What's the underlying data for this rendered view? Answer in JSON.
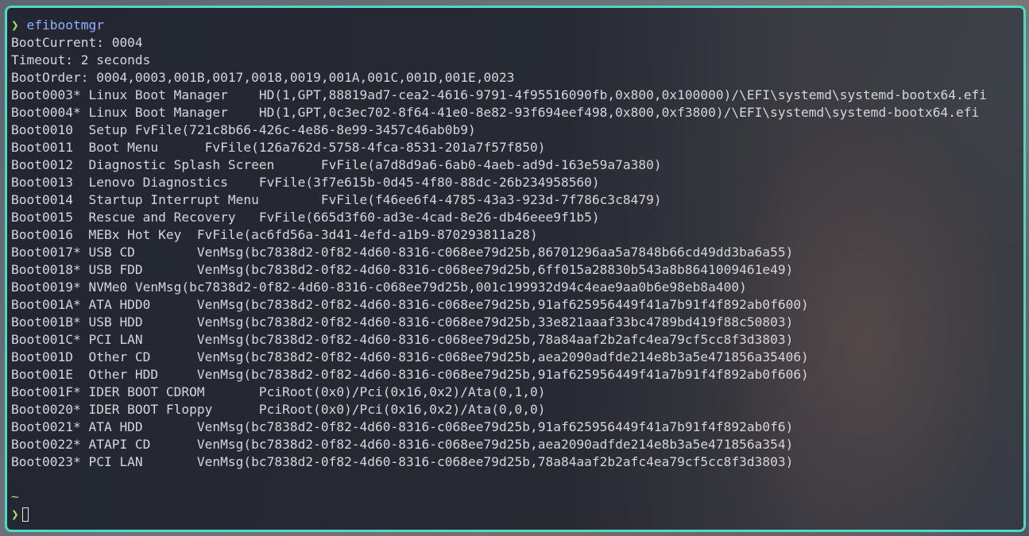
{
  "prompt": {
    "symbol": "❯",
    "command": "efibootmgr"
  },
  "output": [
    "BootCurrent: 0004",
    "Timeout: 2 seconds",
    "BootOrder: 0004,0003,001B,0017,0018,0019,001A,001C,001D,001E,0023",
    "Boot0003* Linux Boot Manager    HD(1,GPT,88819ad7-cea2-4616-9791-4f95516090fb,0x800,0x100000)/\\EFI\\systemd\\systemd-bootx64.efi",
    "Boot0004* Linux Boot Manager    HD(1,GPT,0c3ec702-8f64-41e0-8e82-93f694eef498,0x800,0xf3800)/\\EFI\\systemd\\systemd-bootx64.efi",
    "Boot0010  Setup FvFile(721c8b66-426c-4e86-8e99-3457c46ab0b9)",
    "Boot0011  Boot Menu      FvFile(126a762d-5758-4fca-8531-201a7f57f850)",
    "Boot0012  Diagnostic Splash Screen      FvFile(a7d8d9a6-6ab0-4aeb-ad9d-163e59a7a380)",
    "Boot0013  Lenovo Diagnostics    FvFile(3f7e615b-0d45-4f80-88dc-26b234958560)",
    "Boot0014  Startup Interrupt Menu        FvFile(f46ee6f4-4785-43a3-923d-7f786c3c8479)",
    "Boot0015  Rescue and Recovery   FvFile(665d3f60-ad3e-4cad-8e26-db46eee9f1b5)",
    "Boot0016  MEBx Hot Key  FvFile(ac6fd56a-3d41-4efd-a1b9-870293811a28)",
    "Boot0017* USB CD        VenMsg(bc7838d2-0f82-4d60-8316-c068ee79d25b,86701296aa5a7848b66cd49dd3ba6a55)",
    "Boot0018* USB FDD       VenMsg(bc7838d2-0f82-4d60-8316-c068ee79d25b,6ff015a28830b543a8b8641009461e49)",
    "Boot0019* NVMe0 VenMsg(bc7838d2-0f82-4d60-8316-c068ee79d25b,001c199932d94c4eae9aa0b6e98eb8a400)",
    "Boot001A* ATA HDD0      VenMsg(bc7838d2-0f82-4d60-8316-c068ee79d25b,91af625956449f41a7b91f4f892ab0f600)",
    "Boot001B* USB HDD       VenMsg(bc7838d2-0f82-4d60-8316-c068ee79d25b,33e821aaaf33bc4789bd419f88c50803)",
    "Boot001C* PCI LAN       VenMsg(bc7838d2-0f82-4d60-8316-c068ee79d25b,78a84aaf2b2afc4ea79cf5cc8f3d3803)",
    "Boot001D  Other CD      VenMsg(bc7838d2-0f82-4d60-8316-c068ee79d25b,aea2090adfde214e8b3a5e471856a35406)",
    "Boot001E  Other HDD     VenMsg(bc7838d2-0f82-4d60-8316-c068ee79d25b,91af625956449f41a7b91f4f892ab0f606)",
    "Boot001F* IDER BOOT CDROM       PciRoot(0x0)/Pci(0x16,0x2)/Ata(0,1,0)",
    "Boot0020* IDER BOOT Floppy      PciRoot(0x0)/Pci(0x16,0x2)/Ata(0,0,0)",
    "Boot0021* ATA HDD       VenMsg(bc7838d2-0f82-4d60-8316-c068ee79d25b,91af625956449f41a7b91f4f892ab0f6)",
    "Boot0022* ATAPI CD      VenMsg(bc7838d2-0f82-4d60-8316-c068ee79d25b,aea2090adfde214e8b3a5e471856a354)",
    "Boot0023* PCI LAN       VenMsg(bc7838d2-0f82-4d60-8316-c068ee79d25b,78a84aaf2b2afc4ea79cf5cc8f3d3803)"
  ],
  "footer": {
    "cwd": "~",
    "symbol": "❯"
  },
  "colors": {
    "border": "#4fd8c4",
    "prompt": "#9fe070",
    "command": "#8fb0ff",
    "text": "#d4d6da"
  }
}
